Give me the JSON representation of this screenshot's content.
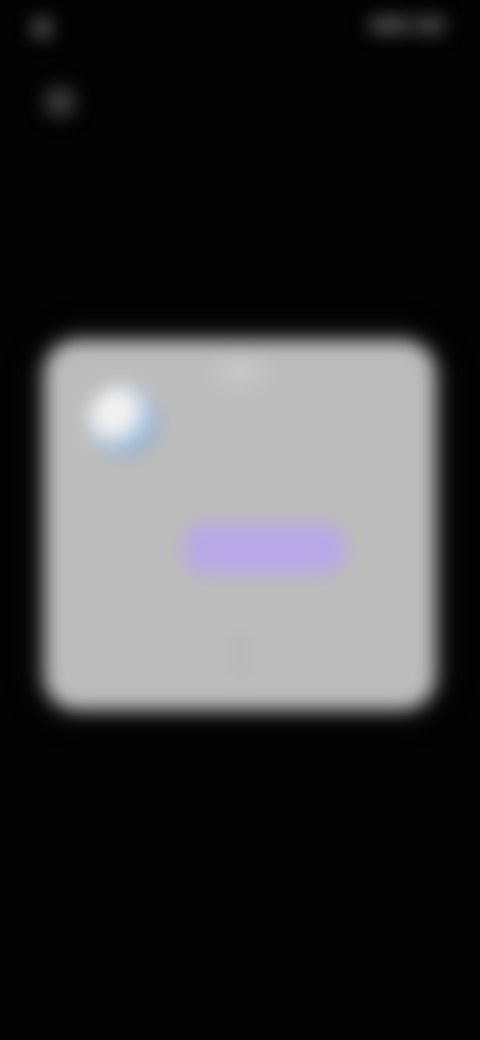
{
  "status_bar": {
    "time": "",
    "right_indicators": ""
  },
  "topbar": {
    "back_icon": "back-icon"
  },
  "dialog": {
    "title": "",
    "body": "",
    "buttons": [
      {
        "label": ""
      },
      {
        "label": ""
      }
    ],
    "highlight_color": "#b8a8e8",
    "background_color": "#bcbcbc"
  },
  "colors": {
    "screen_background": "#030303"
  }
}
